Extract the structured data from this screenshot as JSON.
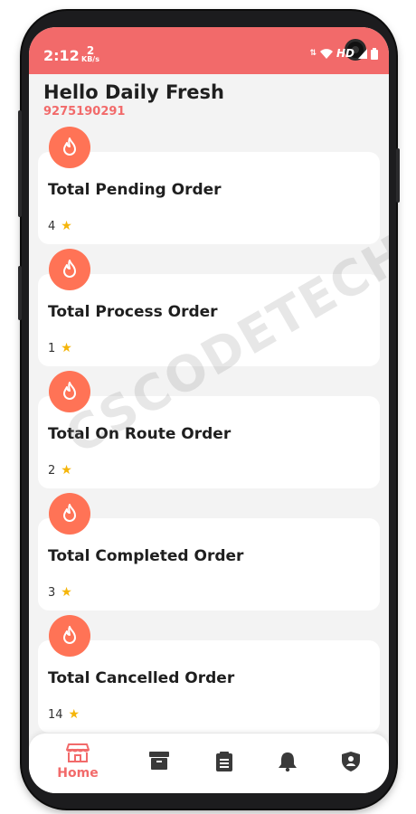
{
  "status_bar": {
    "time": "2:12",
    "speed_value": "2",
    "speed_unit": "KB/s",
    "network": "HD"
  },
  "header": {
    "greeting": "Hello Daily Fresh",
    "phone": "9275190291"
  },
  "cards": [
    {
      "label": "Total Pending Order",
      "count": "4"
    },
    {
      "label": "Total Process Order",
      "count": "1"
    },
    {
      "label": "Total On Route Order",
      "count": "2"
    },
    {
      "label": "Total Completed Order",
      "count": "3"
    },
    {
      "label": "Total Cancelled Order",
      "count": "14"
    }
  ],
  "watermark": "CSCODETECH",
  "bottom_nav": {
    "home_label": "Home",
    "items": [
      {
        "icon": "store-icon"
      },
      {
        "icon": "archive-icon"
      },
      {
        "icon": "list-icon"
      },
      {
        "icon": "bell-icon"
      },
      {
        "icon": "shield-user-icon"
      }
    ]
  },
  "colors": {
    "accent": "#f26a6a",
    "badge": "#ff7356",
    "star": "#f5b50a",
    "background": "#f3f3f3"
  }
}
